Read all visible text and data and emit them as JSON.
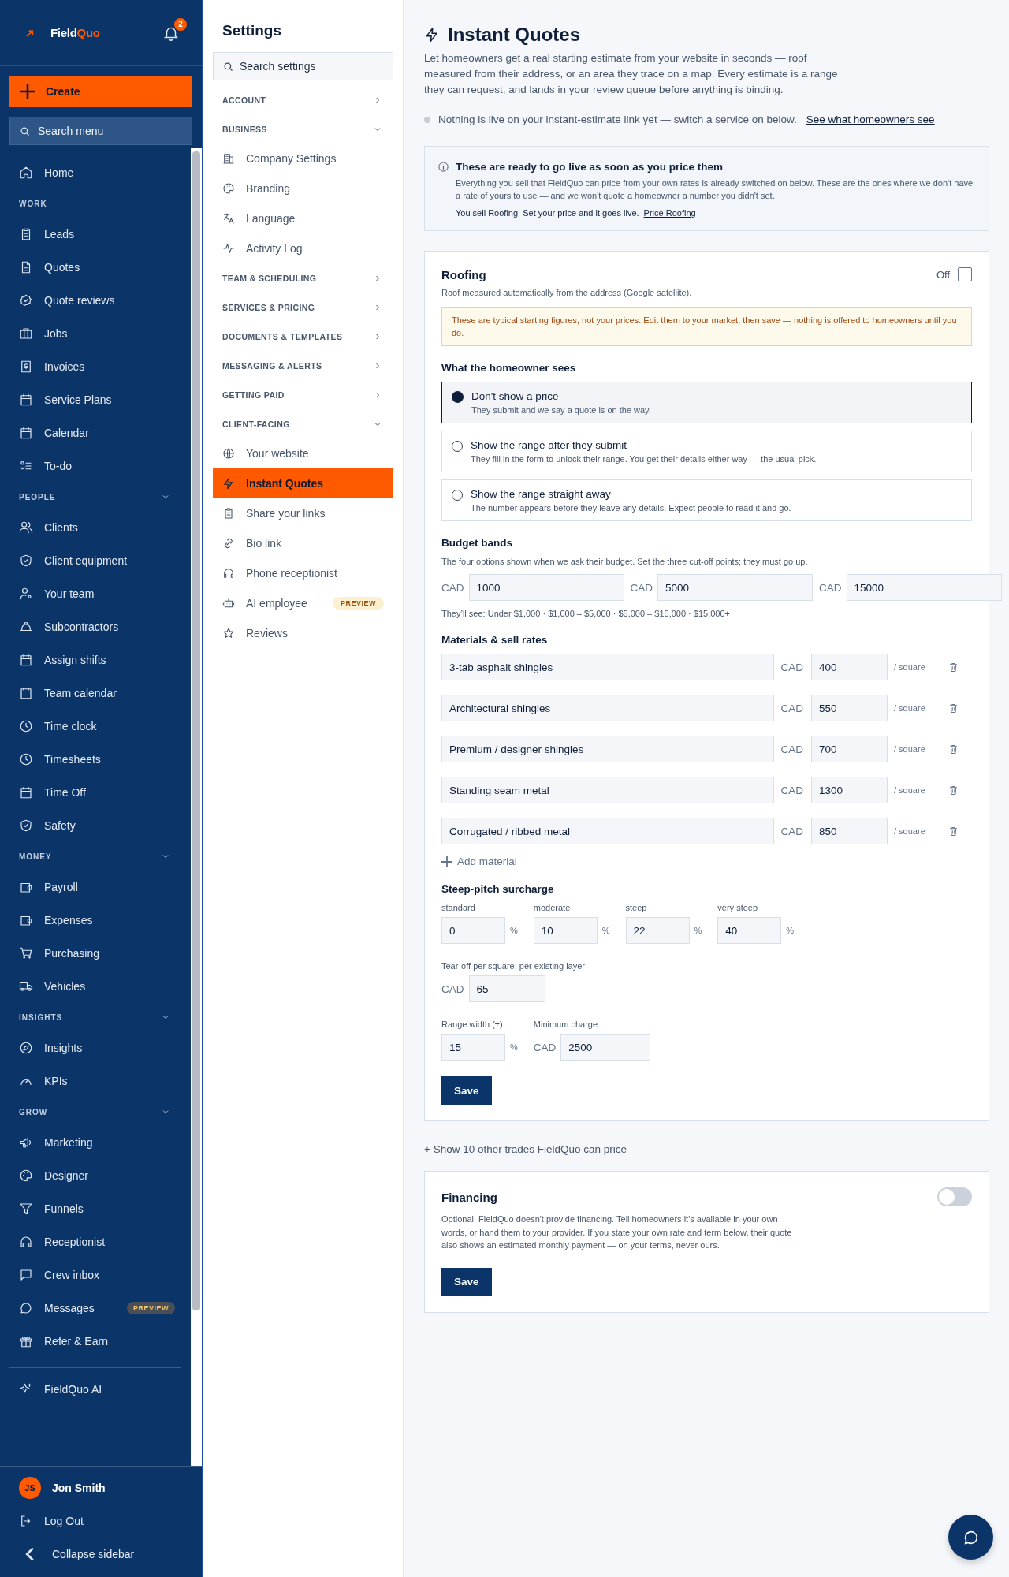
{
  "app_sidebar": {
    "brand_prefix": "Field",
    "brand_suffix": "Quo",
    "notification_count": "2",
    "create_button": "Create",
    "search": {
      "placeholder": "Search menu"
    },
    "sections": [
      {
        "items": [
          {
            "label": "Home"
          }
        ]
      },
      {
        "heading": "WORK",
        "items": [
          {
            "label": "Leads"
          },
          {
            "label": "Quotes"
          },
          {
            "label": "Quote reviews"
          },
          {
            "label": "Jobs"
          },
          {
            "label": "Invoices"
          },
          {
            "label": "Service Plans"
          },
          {
            "label": "Calendar"
          },
          {
            "label": "To-do"
          }
        ]
      },
      {
        "heading": "PEOPLE",
        "expanded": true,
        "items": [
          {
            "label": "Clients"
          },
          {
            "label": "Client equipment"
          },
          {
            "label": "Your team"
          },
          {
            "label": "Subcontractors"
          },
          {
            "label": "Assign shifts"
          },
          {
            "label": "Team calendar"
          },
          {
            "label": "Time clock"
          },
          {
            "label": "Timesheets"
          },
          {
            "label": "Time Off"
          },
          {
            "label": "Safety"
          }
        ]
      },
      {
        "heading": "MONEY",
        "expanded": true,
        "items": [
          {
            "label": "Payroll"
          },
          {
            "label": "Expenses"
          },
          {
            "label": "Purchasing"
          },
          {
            "label": "Vehicles"
          }
        ]
      },
      {
        "heading": "INSIGHTS",
        "expanded": true,
        "items": [
          {
            "label": "Insights"
          },
          {
            "label": "KPIs"
          }
        ]
      },
      {
        "heading": "GROW",
        "expanded": true,
        "items": [
          {
            "label": "Marketing"
          },
          {
            "label": "Designer"
          },
          {
            "label": "Funnels"
          },
          {
            "label": "Receptionist"
          },
          {
            "label": "Crew inbox"
          },
          {
            "label": "Messages",
            "badge": "PREVIEW"
          },
          {
            "label": "Refer & Earn"
          }
        ]
      },
      {
        "items": [
          {
            "label": "FieldQuo AI"
          }
        ]
      }
    ],
    "user": {
      "initials": "JS",
      "name": "Jon Smith"
    },
    "log_out": "Log Out",
    "collapse": "Collapse sidebar"
  },
  "settings_nav": {
    "title": "Settings",
    "search": {
      "placeholder": "Search settings"
    },
    "groups": [
      {
        "heading": "ACCOUNT",
        "expanded": false
      },
      {
        "heading": "BUSINESS",
        "expanded": true,
        "items": [
          {
            "label": "Company Settings",
            "selected": false
          },
          {
            "label": "Branding",
            "selected": false
          },
          {
            "label": "Language",
            "selected": false
          },
          {
            "label": "Activity Log",
            "selected": false
          }
        ]
      },
      {
        "heading": "TEAM & SCHEDULING",
        "expanded": false
      },
      {
        "heading": "SERVICES & PRICING",
        "expanded": false
      },
      {
        "heading": "DOCUMENTS & TEMPLATES",
        "expanded": false
      },
      {
        "heading": "MESSAGING & ALERTS",
        "expanded": false
      },
      {
        "heading": "GETTING PAID",
        "expanded": false
      },
      {
        "heading": "CLIENT-FACING",
        "expanded": true,
        "items": [
          {
            "label": "Your website",
            "selected": false
          },
          {
            "label": "Instant Quotes",
            "selected": true
          },
          {
            "label": "Share your links",
            "selected": false
          },
          {
            "label": "Bio link",
            "selected": false
          },
          {
            "label": "Phone receptionist",
            "selected": false
          },
          {
            "label": "AI employee",
            "selected": false,
            "badge": "PREVIEW"
          },
          {
            "label": "Reviews",
            "selected": false
          }
        ]
      }
    ]
  },
  "page": {
    "title": "Instant Quotes",
    "intro": "Let homeowners get a real starting estimate from your website in seconds — roof measured from their address, or an area they trace on a map. Every estimate is a range they can request, and lands in your review queue before anything is binding.",
    "status": {
      "text": "Nothing is live on your instant-estimate link yet — switch a service on below.",
      "link": "See what homeowners see"
    },
    "info": {
      "title": "These are ready to go live as soon as you price them",
      "body": "Everything you sell that FieldQuo can price from your own rates is already switched on below. These are the ones where we don't have a rate of yours to use — and we won't quote a homeowner a number you didn't set.",
      "cta": "You sell Roofing. Set your price and it goes live.",
      "link": "Price Roofing"
    },
    "roofing": {
      "title": "Roofing",
      "toggle_label": "Off",
      "on": false,
      "subtitle": "Roof measured automatically from the address (Google satellite).",
      "warning": "These are typical starting figures, not your prices. Edit them to your market, then save — nothing is offered to homeowners until you do.",
      "display_heading": "What the homeowner sees",
      "display_options": [
        {
          "label": "Don't show a price",
          "description": "They submit and we say a quote is on the way.",
          "selected": true
        },
        {
          "label": "Show the range after they submit",
          "description": "They fill in the form to unlock their range. You get their details either way — the usual pick.",
          "selected": false
        },
        {
          "label": "Show the range straight away",
          "description": "The number appears before they leave any details. Expect people to read it and go.",
          "selected": false
        }
      ],
      "budget": {
        "heading": "Budget bands",
        "hint": "The four options shown when we ask their budget. Set the three cut-off points; they must go up.",
        "cutoffs": [
          {
            "currency": "CAD",
            "value": "1000"
          },
          {
            "currency": "CAD",
            "value": "5000"
          },
          {
            "currency": "CAD",
            "value": "15000"
          }
        ],
        "preview": "They’ll see: Under $1,000 · $1,000 – $5,000 · $5,000 – $15,000 · $15,000+"
      },
      "materials": {
        "heading": "Materials & sell rates",
        "rows": [
          {
            "name": "3-tab asphalt shingles",
            "currency": "CAD",
            "rate": "400",
            "unit": "/ square"
          },
          {
            "name": "Architectural shingles",
            "currency": "CAD",
            "rate": "550",
            "unit": "/ square"
          },
          {
            "name": "Premium / designer shingles",
            "currency": "CAD",
            "rate": "700",
            "unit": "/ square"
          },
          {
            "name": "Standing seam metal",
            "currency": "CAD",
            "rate": "1300",
            "unit": "/ square"
          },
          {
            "name": "Corrugated / ribbed metal",
            "currency": "CAD",
            "rate": "850",
            "unit": "/ square"
          }
        ],
        "add_button": "Add material"
      },
      "surcharge": {
        "heading": "Steep-pitch surcharge",
        "tiers": [
          {
            "label": "standard",
            "value": "0",
            "unit": "%"
          },
          {
            "label": "moderate",
            "value": "10",
            "unit": "%"
          },
          {
            "label": "steep",
            "value": "22",
            "unit": "%"
          },
          {
            "label": "very steep",
            "value": "40",
            "unit": "%"
          }
        ]
      },
      "tear_off": {
        "label": "Tear-off per square, per existing layer",
        "currency": "CAD",
        "value": "65"
      },
      "range_width": {
        "label": "Range width (±)",
        "value": "15",
        "unit": "%"
      },
      "minimum": {
        "label": "Minimum charge",
        "currency": "CAD",
        "value": "2500"
      },
      "save_button": "Save"
    },
    "more_trades": "+ Show 10 other trades FieldQuo can price",
    "financing": {
      "title": "Financing",
      "on": false,
      "description": "Optional. FieldQuo doesn't provide financing. Tell homeowners it's available in your own words, or hand them to your provider. If you state your own rate and term below, their quote also shows an estimated monthly payment — on your terms, never ours.",
      "save_button": "Save"
    }
  }
}
